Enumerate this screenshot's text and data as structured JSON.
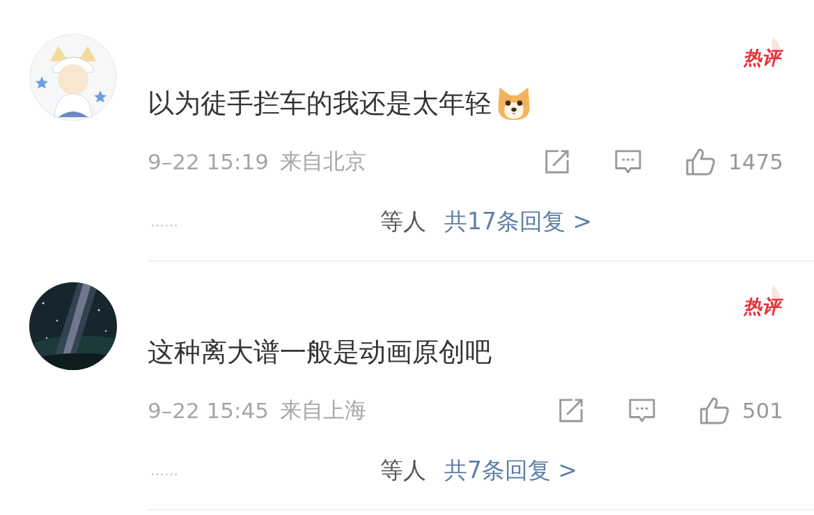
{
  "comments": [
    {
      "avatar": {
        "kind": "figure"
      },
      "badge": "热评",
      "text": "以为徒手拦车的我还是太年轻",
      "emoji": true,
      "time": "9–22 15:19",
      "location": "来自北京",
      "likes": "1475",
      "reply_prefix": "……",
      "reply_names": "等人",
      "reply_link": "共17条回复 >"
    },
    {
      "badge": "热评",
      "text": "这种离大谱一般是动画原创吧",
      "time": "9–22 15:45",
      "location": "来自上海",
      "likes": "501",
      "reply_prefix": "……",
      "reply_names": "等人",
      "reply_link": "共7条回复 >"
    }
  ]
}
